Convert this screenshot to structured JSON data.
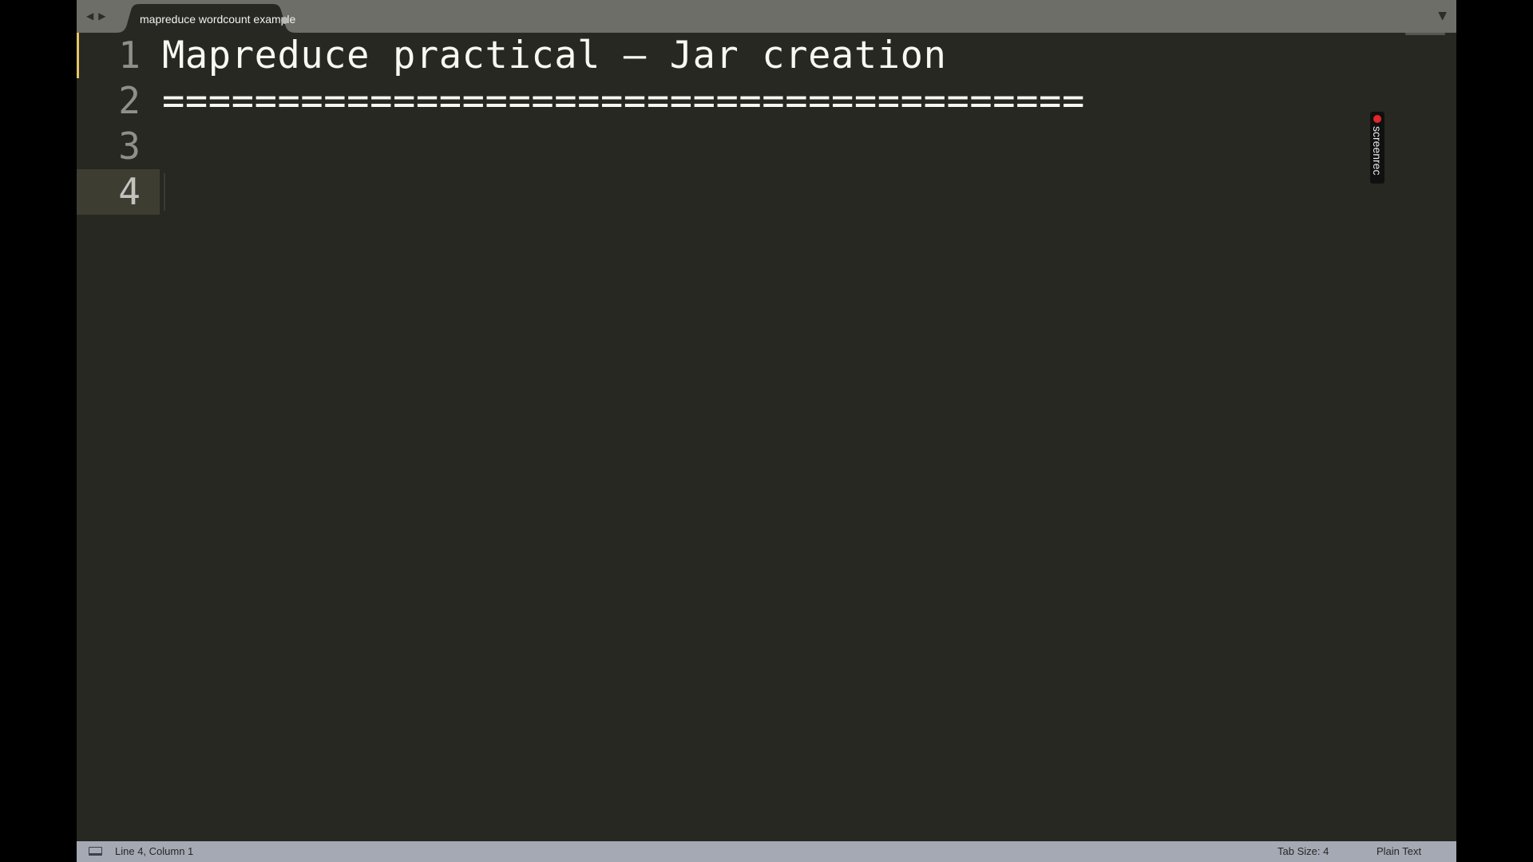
{
  "window": {
    "title": "mapreduce wordcount example"
  },
  "tabbar": {
    "back_icon": "triangle-left",
    "forward_icon": "triangle-right",
    "tabs": [
      {
        "label": "mapreduce wordcount example",
        "dirty": true
      }
    ],
    "dropdown_icon": "triangle-down"
  },
  "editor": {
    "current_line": 4,
    "lines": [
      {
        "number": "1",
        "text": "Mapreduce practical – Jar creation"
      },
      {
        "number": "2",
        "text": "========================================"
      },
      {
        "number": "3",
        "text": ""
      },
      {
        "number": "4",
        "text": ""
      }
    ]
  },
  "overlay": {
    "recorder_label": "screenrec",
    "recorder_color": "#e2262c"
  },
  "statusbar": {
    "position": "Line 4, Column 1",
    "tab_size": "Tab Size: 4",
    "syntax": "Plain Text"
  },
  "colors": {
    "editor_bg": "#272822",
    "tabbar_bg": "#6d6e68",
    "statusbar_bg": "#a5a9b3",
    "modified_marker": "#e6c566",
    "text": "#f8f8f2"
  }
}
